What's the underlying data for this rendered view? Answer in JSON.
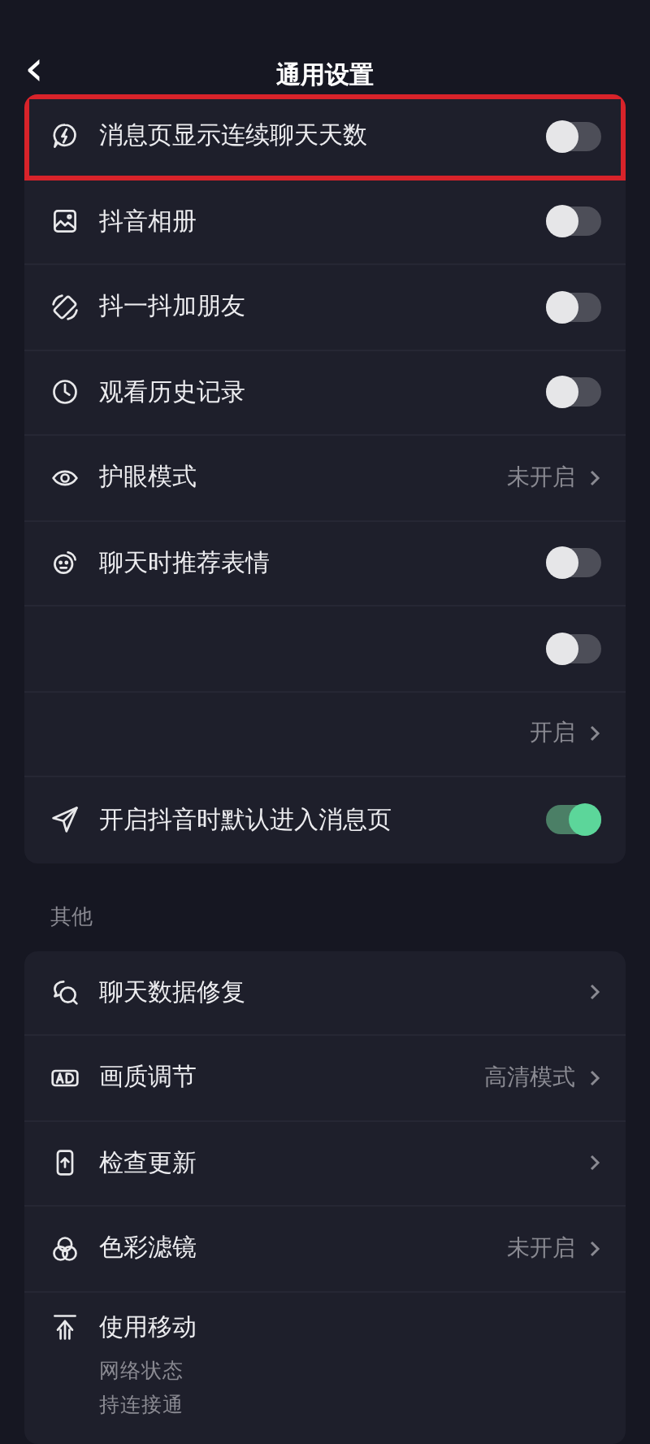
{
  "header": {
    "back": "‹",
    "title": "通用设置"
  },
  "sections": [
    {
      "rows": [
        {
          "kind": "toggle",
          "label": "消息页显示连续聊天天数",
          "on": false,
          "highlighted": true
        },
        {
          "kind": "toggle",
          "label": "抖音相册",
          "on": false,
          "highlighted": false
        },
        {
          "kind": "toggle",
          "label": "抖一抖加朋友",
          "on": false,
          "highlighted": false
        },
        {
          "kind": "toggle",
          "label": "观看历史记录",
          "on": false,
          "highlighted": false
        },
        {
          "kind": "link",
          "label": "护眼模式",
          "value": "未开启",
          "highlighted": false
        },
        {
          "kind": "toggle",
          "label": "聊天时推荐表情",
          "on": false,
          "highlighted": false
        },
        {
          "kind": "toggle",
          "on": false,
          "highlighted": false
        },
        {
          "kind": "link",
          "value": "开启",
          "highlighted": false
        },
        {
          "kind": "toggle",
          "label": "开启抖音时默认进入消息页",
          "on": true,
          "highlighted": false
        }
      ]
    },
    {
      "title": "其他",
      "rows": [
        {
          "kind": "link",
          "label": "聊天数据修复",
          "highlighted": false
        },
        {
          "kind": "link",
          "label": "画质调节",
          "value": "高清模式",
          "highlighted": false
        },
        {
          "kind": "link",
          "label": "检查更新",
          "highlighted": false
        },
        {
          "kind": "link",
          "label": "色彩滤镜",
          "value": "未开启",
          "highlighted": false
        },
        {
          "kind": "text",
          "label": "使用移动",
          "description": [
            "网络状态",
            "持连接通"
          ],
          "highlighted": false
        }
      ]
    }
  ]
}
